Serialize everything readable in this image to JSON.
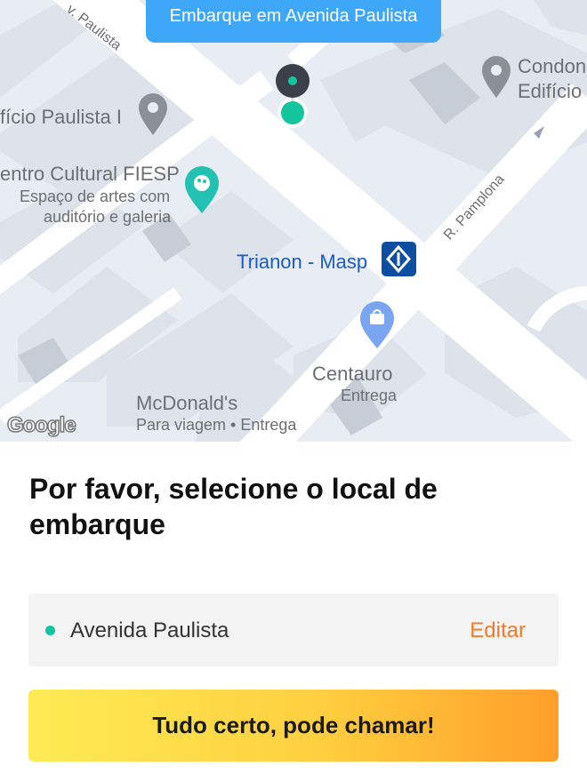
{
  "map": {
    "pickup_bubble": "Embarque em Avenida Paulista",
    "streets": {
      "paulista": "v. Paulista",
      "pamplona": "R. Pamplona"
    },
    "pois": {
      "edificio_paulista": "fício Paulista I",
      "condominio": {
        "line1": "Condon",
        "line2": "Edifício"
      },
      "fiesp": {
        "name": "entro Cultural FIESP",
        "desc1": "Espaço de artes com",
        "desc2": "auditório e galeria"
      },
      "metro": "Trianon - Masp",
      "centauro": {
        "name": "Centauro",
        "sub": "Entrega"
      },
      "mcdonalds": {
        "name": "McDonald's",
        "sub": "Para viagem • Entrega"
      }
    },
    "google_logo": "Google",
    "colors": {
      "bubble": "#3ea7f7",
      "pin_head": "#3a3f4a",
      "pickup_dot": "#14c49e",
      "metro": "#0b4ea2",
      "label_blue": "#1a5cc7",
      "art_pin": "#22c1b2",
      "shop_pin": "#7aa5f0"
    }
  },
  "sheet": {
    "title": "Por favor, selecione o local de embarque",
    "location": {
      "name": "Avenida Paulista",
      "edit": "Editar"
    },
    "confirm_button": "Tudo certo, pode chamar!",
    "colors": {
      "edit": "#f27a28",
      "dot": "#14c49e"
    }
  }
}
